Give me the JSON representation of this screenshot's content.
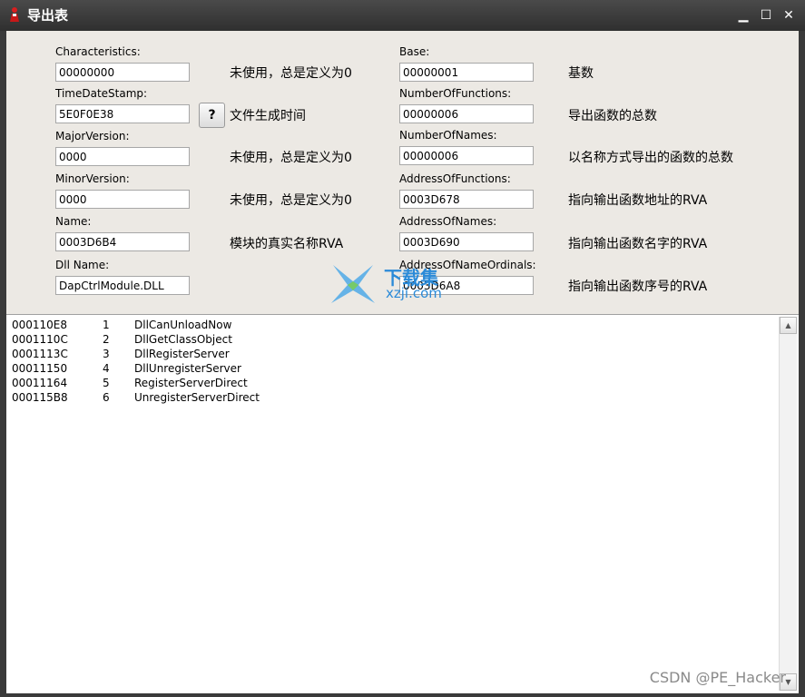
{
  "window": {
    "title": "导出表",
    "minimize": "▁",
    "maximize": "☐",
    "close": "✕"
  },
  "left_fields": [
    {
      "label": "Characteristics:",
      "value": "00000000",
      "desc": "未使用，总是定义为0"
    },
    {
      "label": "TimeDateStamp:",
      "value": "5E0F0E38",
      "desc": "文件生成时间"
    },
    {
      "label": "MajorVersion:",
      "value": "0000",
      "desc": "未使用，总是定义为0"
    },
    {
      "label": "MinorVersion:",
      "value": "0000",
      "desc": "未使用，总是定义为0"
    },
    {
      "label": "Name:",
      "value": "0003D6B4",
      "desc": "模块的真实名称RVA"
    },
    {
      "label": "Dll Name:",
      "value": "DapCtrlModule.DLL",
      "desc": ""
    }
  ],
  "right_fields": [
    {
      "label": "Base:",
      "value": "00000001",
      "desc": "基数"
    },
    {
      "label": "NumberOfFunctions:",
      "value": "00000006",
      "desc": "导出函数的总数"
    },
    {
      "label": "NumberOfNames:",
      "value": "00000006",
      "desc": "以名称方式导出的函数的总数"
    },
    {
      "label": "AddressOfFunctions:",
      "value": "0003D678",
      "desc": "指向输出函数地址的RVA"
    },
    {
      "label": "AddressOfNames:",
      "value": "0003D690",
      "desc": "指向输出函数名字的RVA"
    },
    {
      "label": "AddressOfNameOrdinals:",
      "value": "0003D6A8",
      "desc": "指向输出函数序号的RVA"
    }
  ],
  "help_button": "?",
  "exports": [
    {
      "addr": "000110E8",
      "ord": "1",
      "name": "DllCanUnloadNow"
    },
    {
      "addr": "0001110C",
      "ord": "2",
      "name": "DllGetClassObject"
    },
    {
      "addr": "0001113C",
      "ord": "3",
      "name": "DllRegisterServer"
    },
    {
      "addr": "00011150",
      "ord": "4",
      "name": "DllUnregisterServer"
    },
    {
      "addr": "00011164",
      "ord": "5",
      "name": "RegisterServerDirect"
    },
    {
      "addr": "000115B8",
      "ord": "6",
      "name": "UnregisterServerDirect"
    }
  ],
  "scroll": {
    "up": "▲",
    "down": "▼"
  },
  "watermarks": {
    "site_cn": "下载集",
    "site_en": "xzji.com",
    "csdn": "CSDN @PE_Hacker"
  },
  "colors": {
    "titlebar": "#3a3a3a",
    "client": "#ece9e4",
    "watermark_blue": "#2a8ad8"
  },
  "icons": {
    "app": "red-figure-icon",
    "watermark": "blue-x-logo-icon"
  }
}
